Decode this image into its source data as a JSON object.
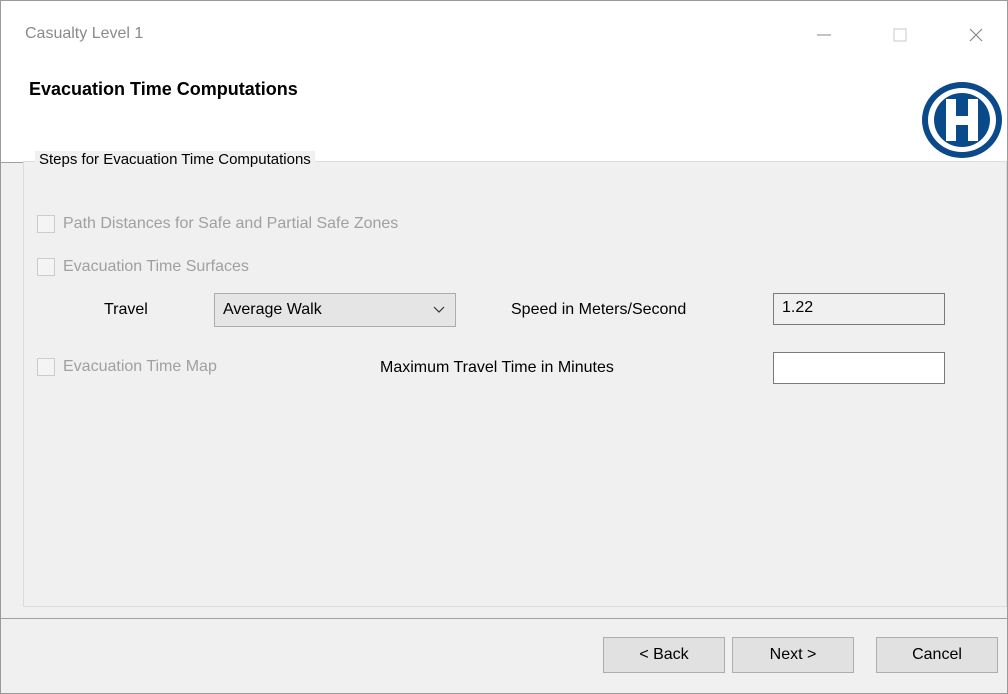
{
  "window": {
    "title": "Casualty Level 1"
  },
  "header": {
    "title": "Evacuation Time Computations",
    "logo_icon": "hazus-logo-icon"
  },
  "group": {
    "legend": "Steps for Evacuation Time Computations",
    "path_distances_label": "Path Distances for Safe and Partial Safe Zones",
    "path_distances_checked": false,
    "evacuation_surfaces_label": "Evacuation Time Surfaces",
    "evacuation_surfaces_checked": false,
    "travel_label": "Travel",
    "travel_value": "Average Walk",
    "speed_label": "Speed in Meters/Second",
    "speed_value": "1.22",
    "evacuation_map_label": "Evacuation Time Map",
    "evacuation_map_checked": false,
    "max_time_label": "Maximum Travel Time in Minutes",
    "max_time_value": ""
  },
  "buttons": {
    "back": "< Back",
    "next": "Next >",
    "cancel": "Cancel"
  },
  "colors": {
    "logo_blue": "#0a4a8a",
    "disabled_text": "#a0a0a0"
  }
}
